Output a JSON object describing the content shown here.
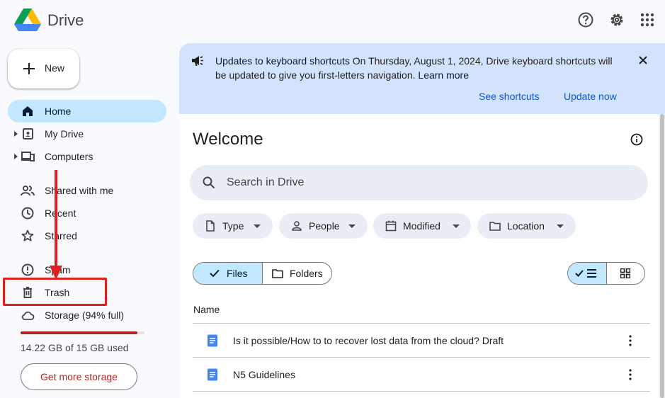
{
  "header": {
    "brand": "Drive"
  },
  "new_button": {
    "label": "New"
  },
  "sidebar": {
    "items": [
      {
        "label": "Home",
        "icon": "home-icon"
      },
      {
        "label": "My Drive",
        "icon": "my-drive-icon"
      },
      {
        "label": "Computers",
        "icon": "computers-icon"
      },
      {
        "label": "Shared with me",
        "icon": "people-icon"
      },
      {
        "label": "Recent",
        "icon": "clock-icon"
      },
      {
        "label": "Starred",
        "icon": "star-icon"
      },
      {
        "label": "Spam",
        "icon": "spam-icon"
      },
      {
        "label": "Trash",
        "icon": "trash-icon"
      },
      {
        "label": "Storage (94% full)",
        "icon": "cloud-icon"
      }
    ]
  },
  "storage": {
    "used_text": "14.22 GB of 15 GB used",
    "percent": 94,
    "bar_color": "#b3261e",
    "cta": "Get more storage"
  },
  "banner": {
    "title": "Updates to keyboard shortcuts",
    "message": " On Thursday, August 1, 2024, Drive keyboard shortcuts will be updated to give you first-letters navigation. ",
    "learn_more": "Learn more",
    "action_shortcuts": "See shortcuts",
    "action_update": "Update now"
  },
  "main": {
    "title": "Welcome",
    "search_placeholder": "Search in Drive",
    "filters": [
      "Type",
      "People",
      "Modified",
      "Location"
    ],
    "segments": {
      "files": "Files",
      "folders": "Folders"
    },
    "column_name": "Name",
    "files": [
      {
        "name": "Is it possible/How to to recover lost data from the cloud? Draft",
        "icon": "docs-icon"
      },
      {
        "name": "N5 Guidelines",
        "icon": "docs-icon"
      }
    ]
  },
  "colors": {
    "accent": "#0b57d0",
    "active_bg": "#c2e7ff",
    "banner_bg": "#d3e3fd",
    "annotation": "#e02020"
  }
}
